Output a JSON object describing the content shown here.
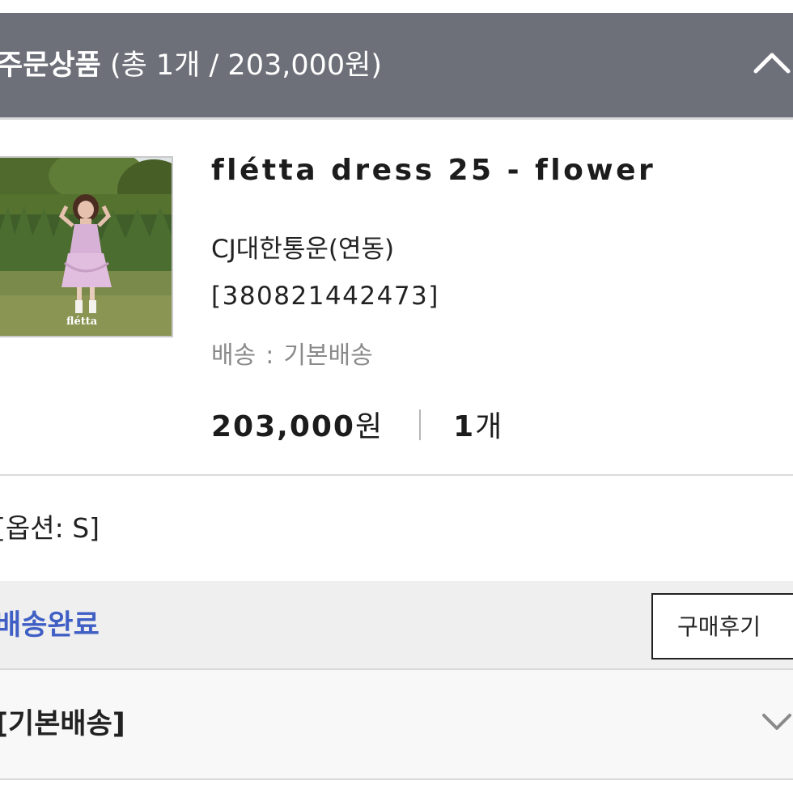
{
  "header": {
    "title": "주문상품",
    "summary": " (총 1개 / 203,000원)"
  },
  "product": {
    "name": "flétta dress 25 - flower",
    "image_watermark": "flétta",
    "courier": "CJ대한통운(연동)",
    "tracking": "[380821442473]",
    "shipping_label": "배송",
    "shipping_separator": ":",
    "shipping_value": "기본배송",
    "price_number": "203,000",
    "price_unit": "원",
    "qty_number": "1",
    "qty_unit": "개"
  },
  "option": {
    "text": "[옵션: S]"
  },
  "status": {
    "label": "배송완료",
    "review_button": "구매후기"
  },
  "shipping_group": {
    "label": "[기본배송]"
  },
  "colors": {
    "header_bg": "#6d7079",
    "status_text": "#3f5fc5",
    "status_bg": "#efefef"
  },
  "icons": {
    "collapse": "chevron-up-icon",
    "expand": "chevron-down-icon"
  }
}
